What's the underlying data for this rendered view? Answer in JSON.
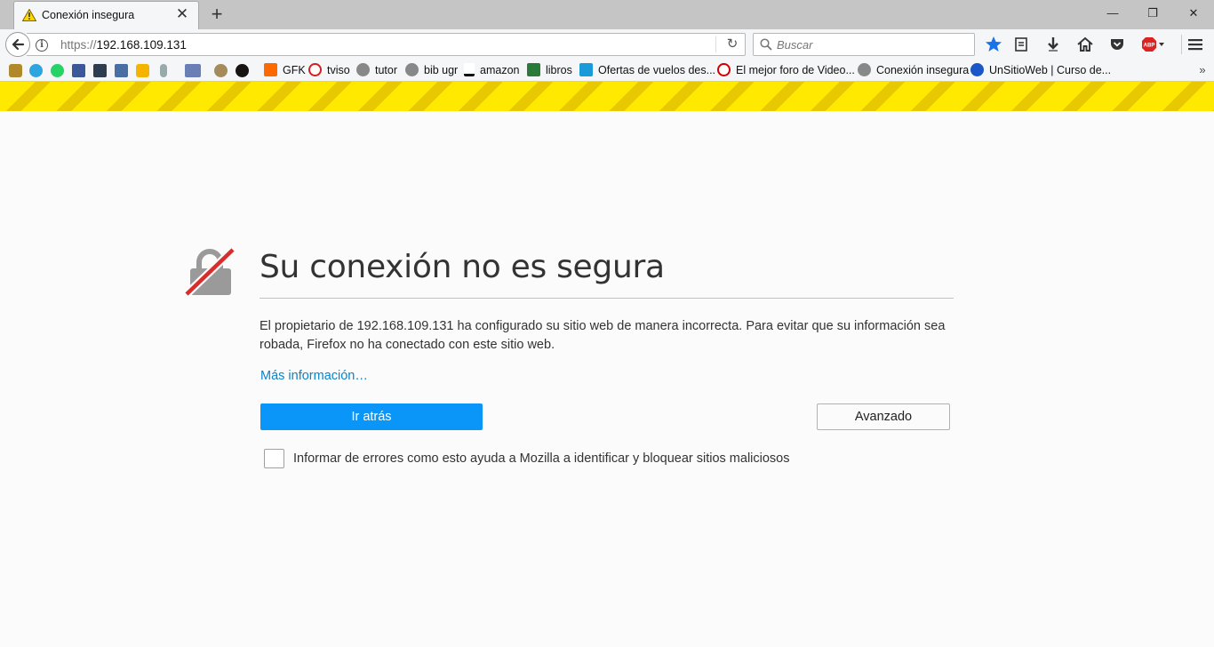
{
  "tab": {
    "title": "Conexión insegura",
    "close_label": "✕",
    "new_tab_label": "+"
  },
  "window_controls": {
    "minimize": "—",
    "restore": "❐",
    "close": "✕"
  },
  "navbar": {
    "url_scheme": "https://",
    "url_host": "192.168.109.131",
    "search_placeholder": "Buscar",
    "reload_label": "↻"
  },
  "bookmarks": {
    "items": [
      {
        "label": "GFK",
        "color": "#ff6a00"
      },
      {
        "label": "tviso",
        "color": "#cc2222"
      },
      {
        "label": "tutor",
        "color": "#777777"
      },
      {
        "label": "bib ugr",
        "color": "#777777"
      },
      {
        "label": "amazon",
        "color": "#111111"
      },
      {
        "label": "libros",
        "color": "#2a7a3a"
      },
      {
        "label": "Ofertas de vuelos des...",
        "color": "#1a9ad8"
      },
      {
        "label": "El mejor foro de Video...",
        "color": "#d00000"
      },
      {
        "label": "Conexión insegura",
        "color": "#777777"
      },
      {
        "label": "UnSitioWeb | Curso de...",
        "color": "#1a56c8"
      }
    ],
    "overflow_label": "»"
  },
  "error": {
    "title": "Su conexión no es segura",
    "description": "El propietario de 192.168.109.131 ha configurado su sitio web de manera incorrecta. Para evitar que su información sea robada, Firefox no ha conectado con este sitio web.",
    "more_info": "Más información…",
    "back_button": "Ir atrás",
    "advanced_button": "Avanzado",
    "report_label": "Informar de errores como esto ayuda a Mozilla a identificar y bloquear sitios maliciosos",
    "report_checked": false
  },
  "colors": {
    "stripe_yellow": "#ffe900",
    "primary_button": "#0996f8",
    "link": "#0a84c7",
    "lock_slash": "#d92d2d"
  }
}
